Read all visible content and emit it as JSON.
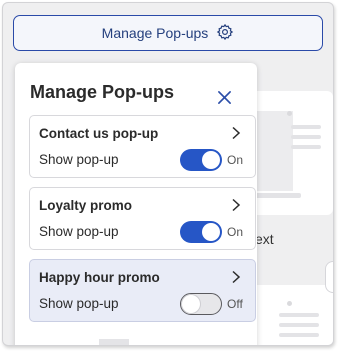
{
  "header": {
    "manage_button_label": "Manage Pop-ups"
  },
  "background": {
    "partial_text": "ext"
  },
  "panel": {
    "title": "Manage Pop-ups",
    "items": [
      {
        "name": "Contact us pop-up",
        "toggle_label": "Show pop-up",
        "state": "On"
      },
      {
        "name": "Loyalty promo",
        "toggle_label": "Show pop-up",
        "state": "On"
      },
      {
        "name": "Happy hour promo",
        "toggle_label": "Show pop-up",
        "state": "Off"
      }
    ]
  },
  "icons": {
    "settings": "gear-icon",
    "close": "close-icon",
    "chevron": "chevron-right-icon"
  },
  "colors": {
    "accent": "#2656c6",
    "button_border": "#2a4aa8",
    "selected_item_bg": "#e9ecf7"
  }
}
